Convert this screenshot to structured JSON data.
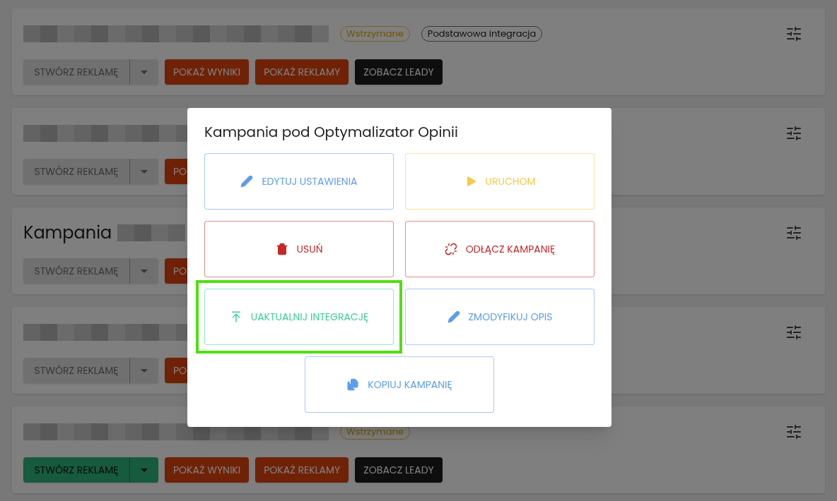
{
  "cards": [
    {
      "badges": [
        {
          "label": "Wstrzymane",
          "kind": "status"
        },
        {
          "label": "Podstawowa integracja",
          "kind": "type"
        }
      ],
      "create_button": {
        "label": "STWÓRZ REKLAMĘ",
        "disabled": true
      },
      "buttons": [
        {
          "label": "POKAŻ WYNIKI",
          "kind": "orange"
        },
        {
          "label": "POKAŻ REKLAMY",
          "kind": "orange"
        },
        {
          "label": "ZOBACZ LEADY",
          "kind": "dark"
        }
      ]
    },
    {
      "create_button": {
        "label": "STWÓRZ REKLAMĘ",
        "disabled": true
      },
      "buttons": [
        {
          "label": "PO",
          "kind": "orange"
        }
      ]
    },
    {
      "title_prefix": "Kampania",
      "create_button": {
        "label": "STWÓRZ REKLAMĘ",
        "disabled": true
      },
      "buttons": [
        {
          "label": "PO",
          "kind": "orange"
        }
      ]
    },
    {
      "create_button": {
        "label": "STWÓRZ REKLAMĘ",
        "disabled": true
      },
      "buttons": [
        {
          "label": "PO",
          "kind": "orange"
        }
      ]
    },
    {
      "badges": [
        {
          "label": "Wstrzymane",
          "kind": "status"
        }
      ],
      "create_button": {
        "label": "STWÓRZ REKLAMĘ",
        "disabled": false
      },
      "buttons": [
        {
          "label": "POKAŻ WYNIKI",
          "kind": "orange"
        },
        {
          "label": "POKAŻ REKLAMY",
          "kind": "orange"
        },
        {
          "label": "ZOBACZ LEADY",
          "kind": "dark"
        }
      ]
    }
  ],
  "modal": {
    "title": "Kampania pod Optymalizator Opinii",
    "actions": [
      {
        "label": "EDYTUJ USTAWIENIA",
        "kind": "edit",
        "color": "#5c9ded",
        "highlighted": false
      },
      {
        "label": "URUCHOM",
        "kind": "play",
        "color": "#f7c948",
        "highlighted": false
      },
      {
        "label": "USUŃ",
        "kind": "delete",
        "color": "#c62828",
        "highlighted": false
      },
      {
        "label": "ODŁĄCZ KAMPANIĘ",
        "kind": "unlink",
        "color": "#c62828",
        "highlighted": false
      },
      {
        "label": "UAKTUALNIJ INTEGRACJĘ",
        "kind": "upload",
        "color": "#3ccf91",
        "highlighted": true
      },
      {
        "label": "ZMODYFIKUJ OPIS",
        "kind": "edit",
        "color": "#5c9ded",
        "highlighted": false
      },
      {
        "label": "KOPIUJ KAMPANIĘ",
        "kind": "copy",
        "color": "#5c9ded",
        "highlighted": false
      }
    ]
  }
}
